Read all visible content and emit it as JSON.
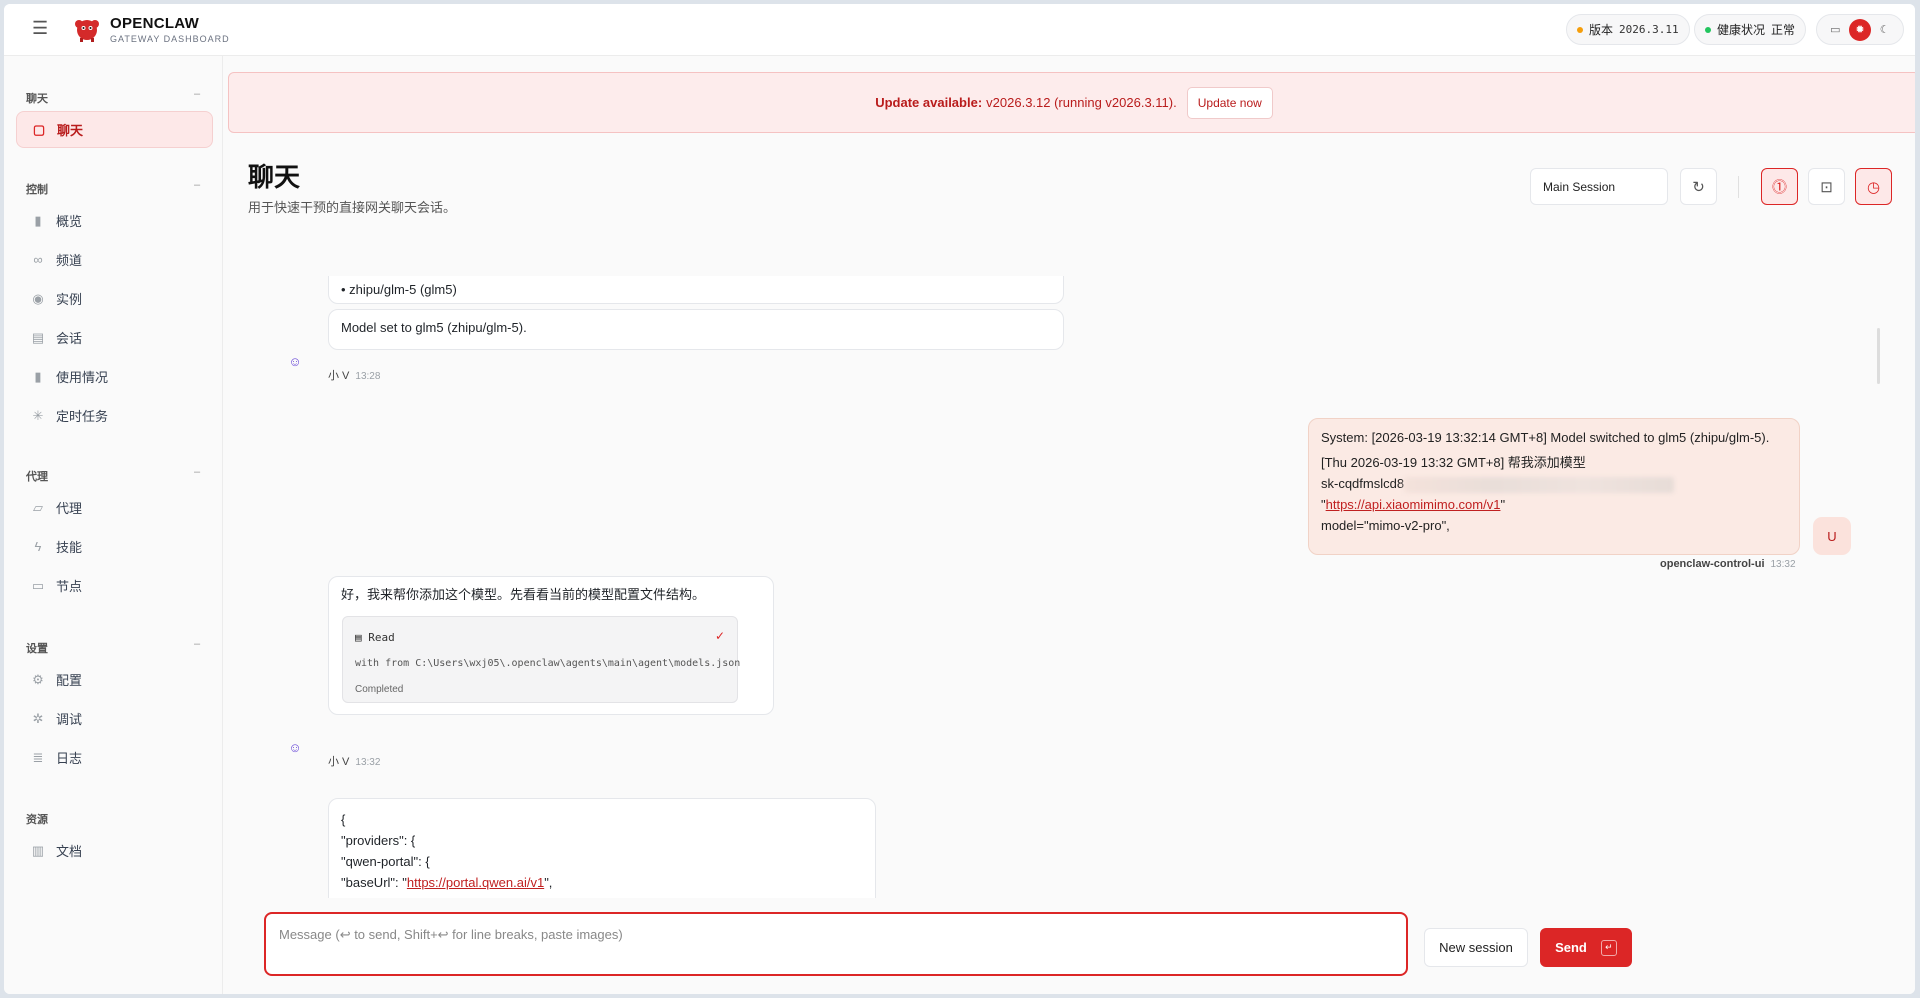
{
  "app": {
    "brand": "OPENCLAW",
    "brand_sub": "GATEWAY DASHBOARD"
  },
  "topbar": {
    "version_label": "版本",
    "version_value": "2026.3.11",
    "health_label": "健康状况",
    "health_value": "正常",
    "theme_options": [
      "monitor",
      "sun",
      "moon"
    ],
    "theme_selected": "sun"
  },
  "colors": {
    "accent": "#dc2626",
    "version_dot": "#f59e0b",
    "health_dot": "#22c55e"
  },
  "sidebar": {
    "sections": [
      {
        "title": "聊天",
        "items": [
          {
            "label": "聊天",
            "icon": "message-icon",
            "active": true
          }
        ]
      },
      {
        "title": "控制",
        "items": [
          {
            "label": "概览",
            "icon": "bar-chart-icon"
          },
          {
            "label": "频道",
            "icon": "link-icon"
          },
          {
            "label": "实例",
            "icon": "broadcast-icon"
          },
          {
            "label": "会话",
            "icon": "file-icon"
          },
          {
            "label": "使用情况",
            "icon": "bar-chart-icon"
          },
          {
            "label": "定时任务",
            "icon": "loader-icon"
          }
        ]
      },
      {
        "title": "代理",
        "items": [
          {
            "label": "代理",
            "icon": "folder-icon"
          },
          {
            "label": "技能",
            "icon": "zap-icon"
          },
          {
            "label": "节点",
            "icon": "monitor-icon"
          }
        ]
      },
      {
        "title": "设置",
        "items": [
          {
            "label": "配置",
            "icon": "gear-icon"
          },
          {
            "label": "调试",
            "icon": "bug-icon"
          },
          {
            "label": "日志",
            "icon": "scroll-icon"
          }
        ]
      },
      {
        "title": "资源",
        "items": [
          {
            "label": "文档",
            "icon": "book-icon"
          }
        ]
      }
    ]
  },
  "banner": {
    "prefix": "Update available:",
    "text": "v2026.3.12 (running v2026.3.11).",
    "button": "Update now"
  },
  "page": {
    "title": "聊天",
    "subtitle": "用于快速干预的直接网关聊天会话。",
    "session_select": "Main Session"
  },
  "messages": {
    "m1_line": "• zhipu/glm-5 (glm5)",
    "m2_text": "Model set to glm5 (zhipu/glm-5).",
    "m2_author": "小 V",
    "m2_time": "13:28",
    "user_line1": "System: [2026-03-19 13:32:14 GMT+8] Model switched to glm5 (zhipu/glm-5).",
    "user_line2": "[Thu 2026-03-19 13:32 GMT+8] 帮我添加模型",
    "user_key": "sk-cqdfmslcd8",
    "user_quote_open": "\"",
    "user_url": "https://api.xiaomimimo.com/v1",
    "user_quote_close": "\"",
    "user_model": "model=\"mimo-v2-pro\",",
    "user_author": "openclaw-control-ui",
    "user_time": "13:32",
    "user_avatar": "U",
    "m3_text": "好，我来帮你添加这个模型。先看看当前的模型配置文件结构。",
    "tool_name": "Read",
    "tool_path": "with from C:\\Users\\wxj05\\.openclaw\\agents\\main\\agent\\models.json",
    "tool_status": "Completed",
    "m3_author": "小 V",
    "m3_time": "13:32",
    "m4_l1": "{",
    "m4_l2": "\"providers\": {",
    "m4_l3": "\"qwen-portal\": {",
    "m4_l4_pre": "\"baseUrl\": \"",
    "m4_l4_url": "https://portal.qwen.ai/v1",
    "m4_l4_post": "\","
  },
  "composer": {
    "placeholder": "Message (↩ to send, Shift+↩ for line breaks, paste images)",
    "new_session": "New session",
    "send": "Send"
  }
}
